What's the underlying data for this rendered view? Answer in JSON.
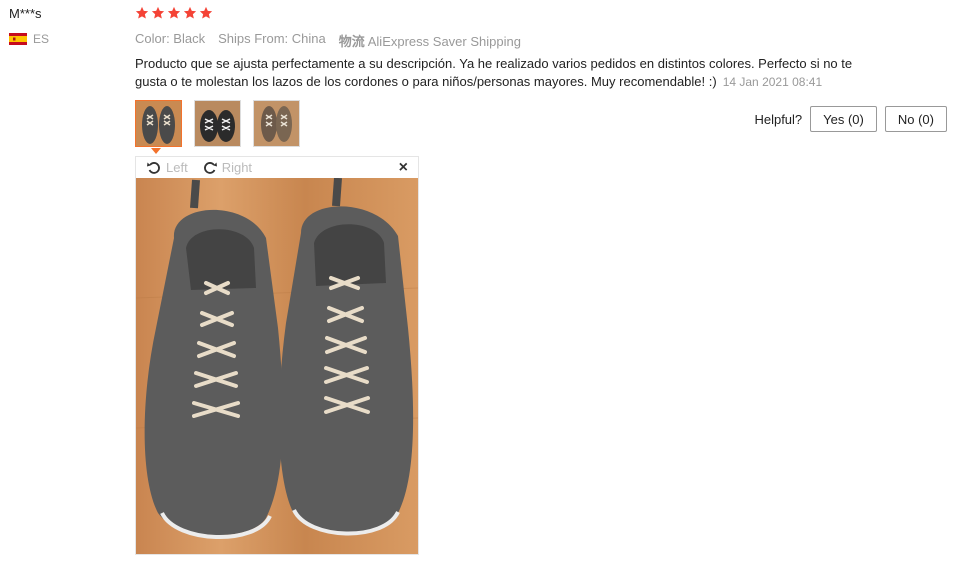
{
  "review": {
    "user_name": "M***s",
    "country_code": "ES",
    "rating": 5,
    "attributes": {
      "color": "Color: Black",
      "ships_from": "Ships From: China",
      "shipping_logo": "物流",
      "shipping": "AliExpress Saver Shipping"
    },
    "text": "Producto que se ajusta perfectamente a su descripción. Ya he realizado varios pedidos en distintos colores. Perfecto si no te gusta o te molestan los lazos de los cordones o para niños/personas mayores. Muy recomendable! :)",
    "date": "14 Jan 2021 08:41"
  },
  "helpful": {
    "label": "Helpful?",
    "yes": "Yes (0)",
    "no": "No (0)"
  },
  "viewer": {
    "rotate_left": "Left",
    "rotate_right": "Right",
    "close": "×"
  },
  "colors": {
    "star": "#f44336",
    "accent": "#f3722c"
  }
}
